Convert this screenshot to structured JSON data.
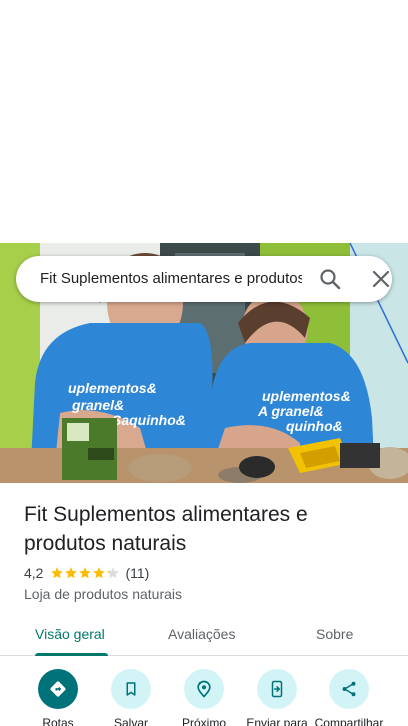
{
  "search": {
    "query": "Fit Suplementos alimentares e produtos naturais"
  },
  "place": {
    "title": "Fit Suplementos alimentares e produtos naturais",
    "rating": "4,2",
    "rating_value": 4.2,
    "rating_max": 5,
    "review_count": "(11)",
    "category": "Loja de produtos naturais"
  },
  "tabs": [
    {
      "label": "Visão geral",
      "active": true
    },
    {
      "label": "Avaliações",
      "active": false
    },
    {
      "label": "Sobre",
      "active": false
    }
  ],
  "actions": [
    {
      "label": "Rotas",
      "icon": "directions-icon"
    },
    {
      "label": "Salvar",
      "icon": "bookmark-icon"
    },
    {
      "label": "Próximo",
      "icon": "nearby-icon"
    },
    {
      "label": "Enviar para",
      "icon": "send-to-phone-icon"
    },
    {
      "label": "Compartilhar",
      "icon": "share-icon"
    }
  ],
  "photo": {
    "shirt_text_left": [
      "uplementos&",
      "granel&",
      "Saquinho&"
    ],
    "shirt_text_right": [
      "uplementos&",
      "A granel&",
      "quinho&"
    ]
  },
  "colors": {
    "accent": "#00796b",
    "action_primary": "#00727a",
    "action_bg": "#d2f4f6",
    "star": "#fbbc04",
    "star_empty": "#dadce0"
  }
}
